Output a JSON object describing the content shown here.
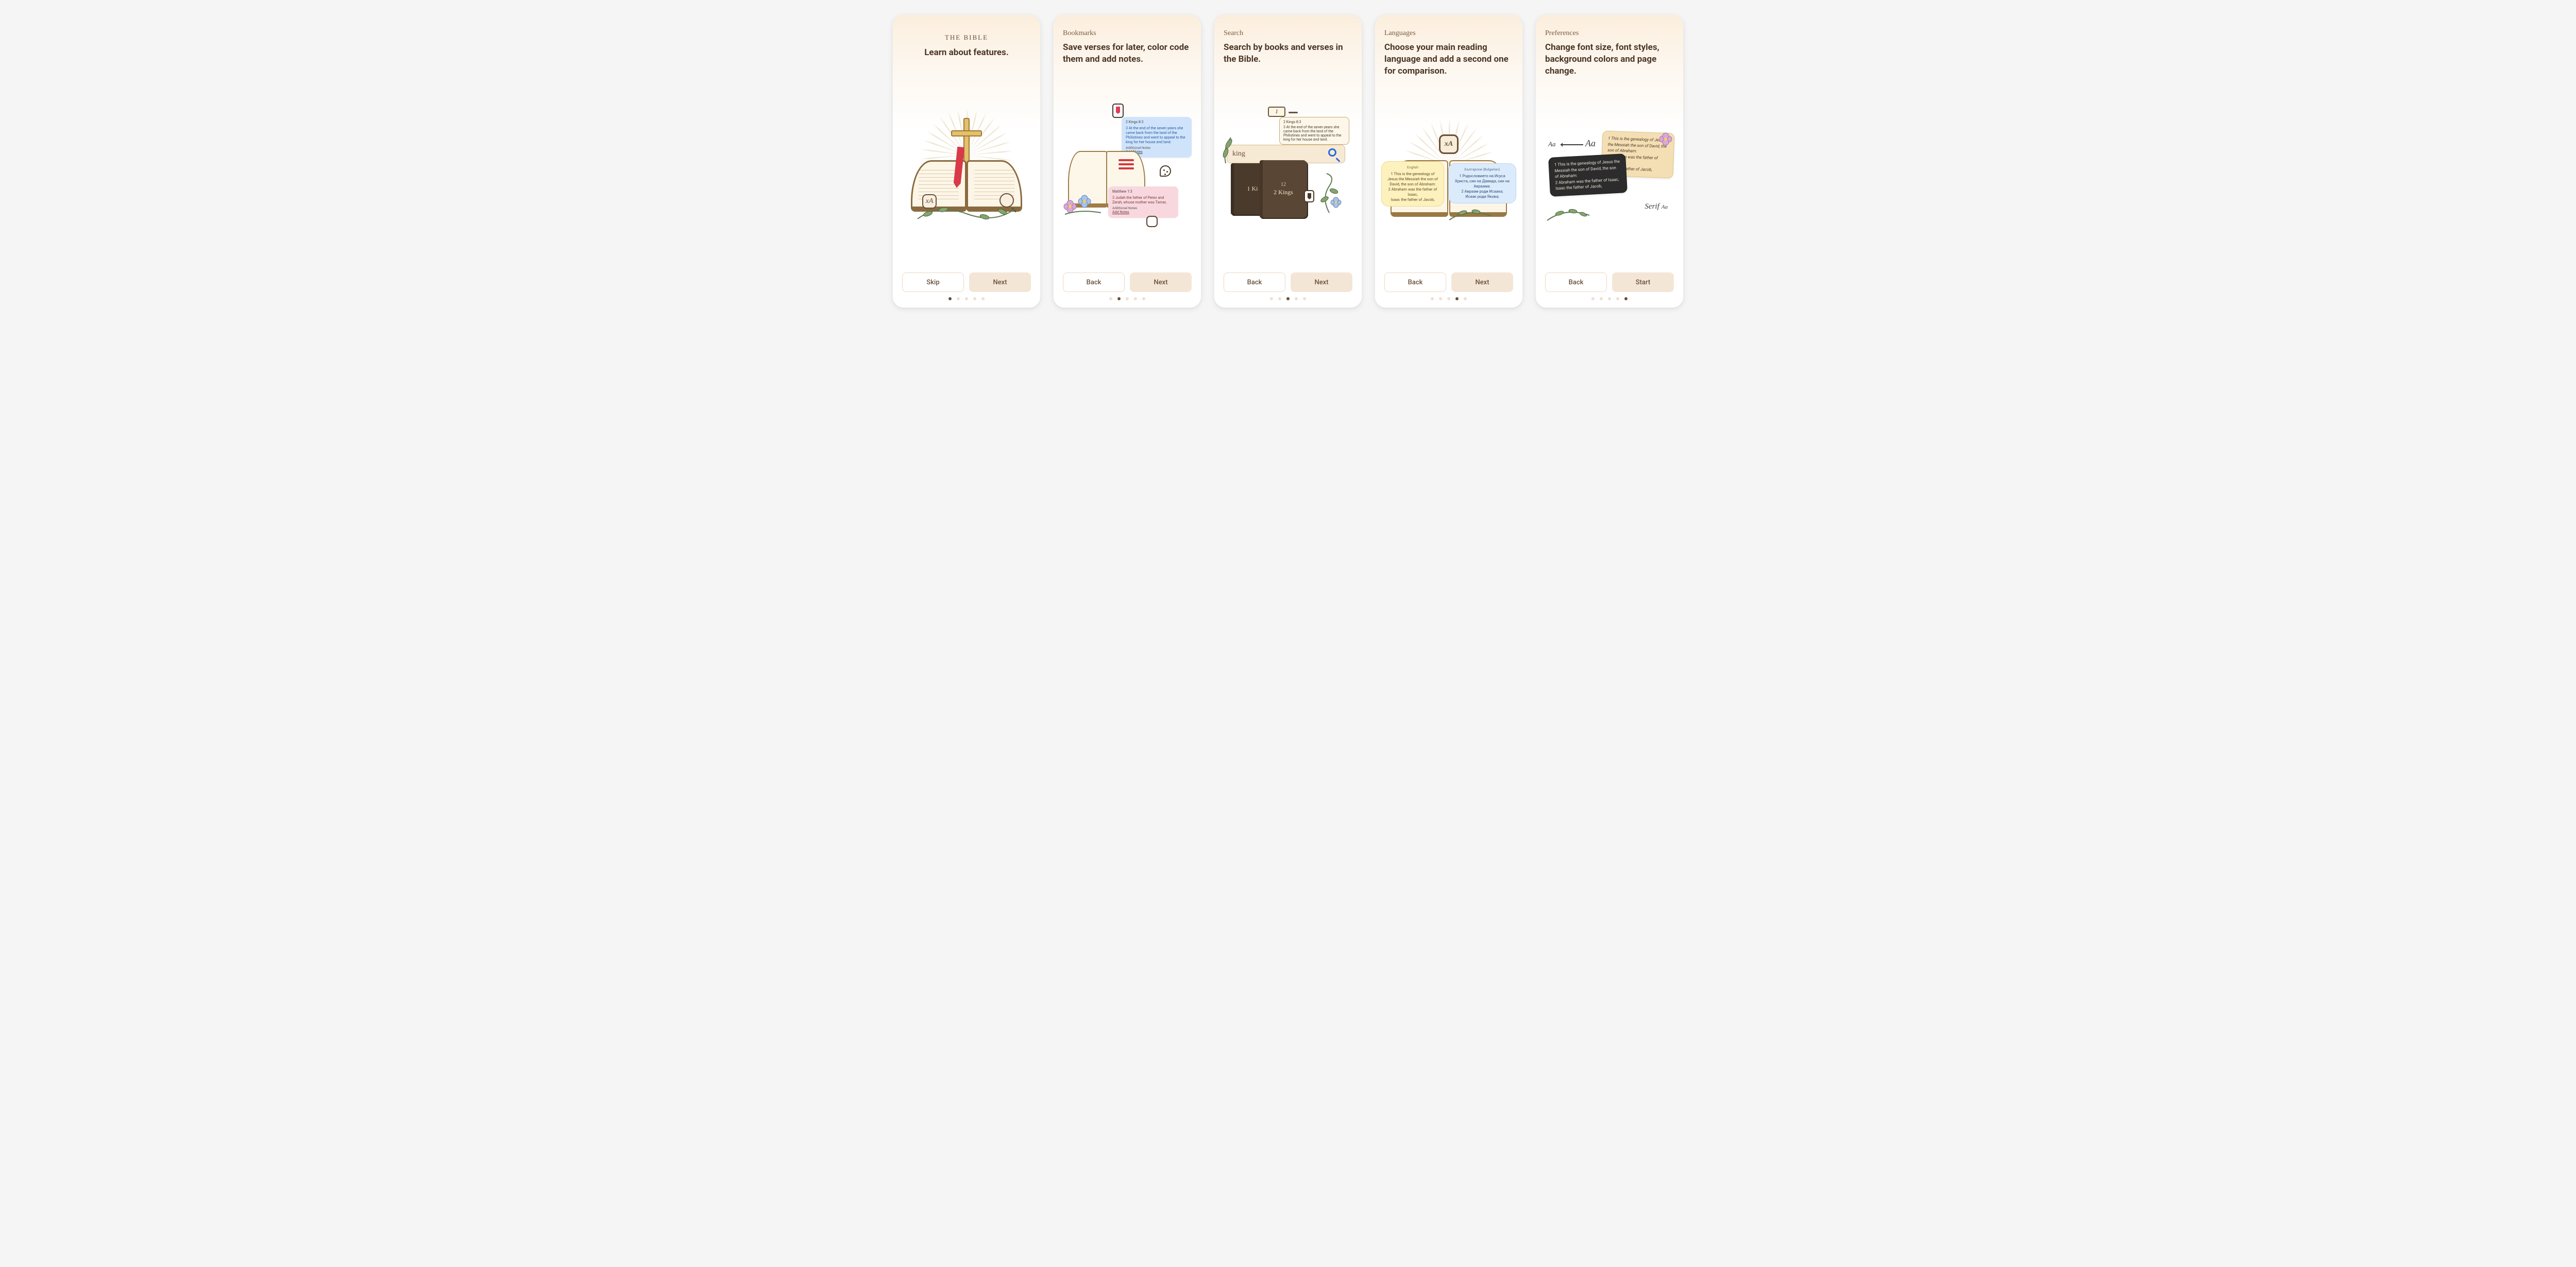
{
  "screens": [
    {
      "pretitle": "THE BIBLE",
      "title": "Learn about features.",
      "lang_icon_text": "xA",
      "left_btn": "Skip",
      "right_btn": "Next",
      "active_dot": 0
    },
    {
      "section": "Bookmarks",
      "title": "Save verses for later, color code them and add notes.",
      "note_blue": {
        "ref": "2 Kings 8:3",
        "verse": "3 At the end of the seven years she came back from the land of the Philistines and went to appeal to the king for her house and land.",
        "addn_label": "Additional Notes",
        "add_link": "Add Notes"
      },
      "note_pink": {
        "ref": "Matthew 1:3",
        "verse": "3 Judah the father of Perez and Zerah, whose mother was Tamar,",
        "addn_label": "Additional Notes",
        "add_link": "Add Notes"
      },
      "left_btn": "Back",
      "right_btn": "Next",
      "active_dot": 1
    },
    {
      "section": "Search",
      "title": "Search by books and verses in the Bible.",
      "tag": "1",
      "versecard": {
        "ref": "2 Kings 8:3",
        "verse": "3 At the end of the seven years she came back from the land of the Philistines and went to appeal to the king for her house and land."
      },
      "query": "king",
      "book_a": "1 Ki",
      "book_b_num": "12",
      "book_b": "2 Kings",
      "left_btn": "Back",
      "right_btn": "Next",
      "active_dot": 2
    },
    {
      "section": "Languages",
      "title": "Choose your main reading language and add a second one for comparison.",
      "lang_icon_text": "xA",
      "bubble_en": {
        "lang": "English",
        "l1": "1 This is the genealogy of Jesus the Messiah the son of David, the son of Abraham:",
        "l2": "2 Abraham was the father of Isaac,",
        "l3": "Isaac the father of Jacob,"
      },
      "bubble_bg": {
        "lang": "Български (Bulgarian)",
        "l1": "1 Родословието на Исуса Христа, син на Давида, син на Авраама.",
        "l2": "2 Авраам роди Исаака;",
        "l3": "Исаак роди Якова;"
      },
      "left_btn": "Back",
      "right_btn": "Next",
      "active_dot": 3
    },
    {
      "section": "Preferences",
      "title": "Change font size, font styles, background colors and page change.",
      "aa_small": "Aa",
      "aa_big": "Aa",
      "serif_label": "Serif",
      "serif_aa": "Aa",
      "card_light": {
        "l1": "1 This is the genealogy of Jesus the Messiah the son of David, the son of Abraham:",
        "l2": "2 Abraham was the father of Isaac,",
        "l3": "Isaac the father of Jacob,"
      },
      "card_dark": {
        "l1": "1 This is the genealogy of Jesus the Messiah the son of David, the son of Abraham:",
        "l2": "2 Abraham was the father of Isaac,",
        "l3": "Isaac the father of Jacob,"
      },
      "left_btn": "Back",
      "right_btn": "Start",
      "active_dot": 4
    }
  ]
}
